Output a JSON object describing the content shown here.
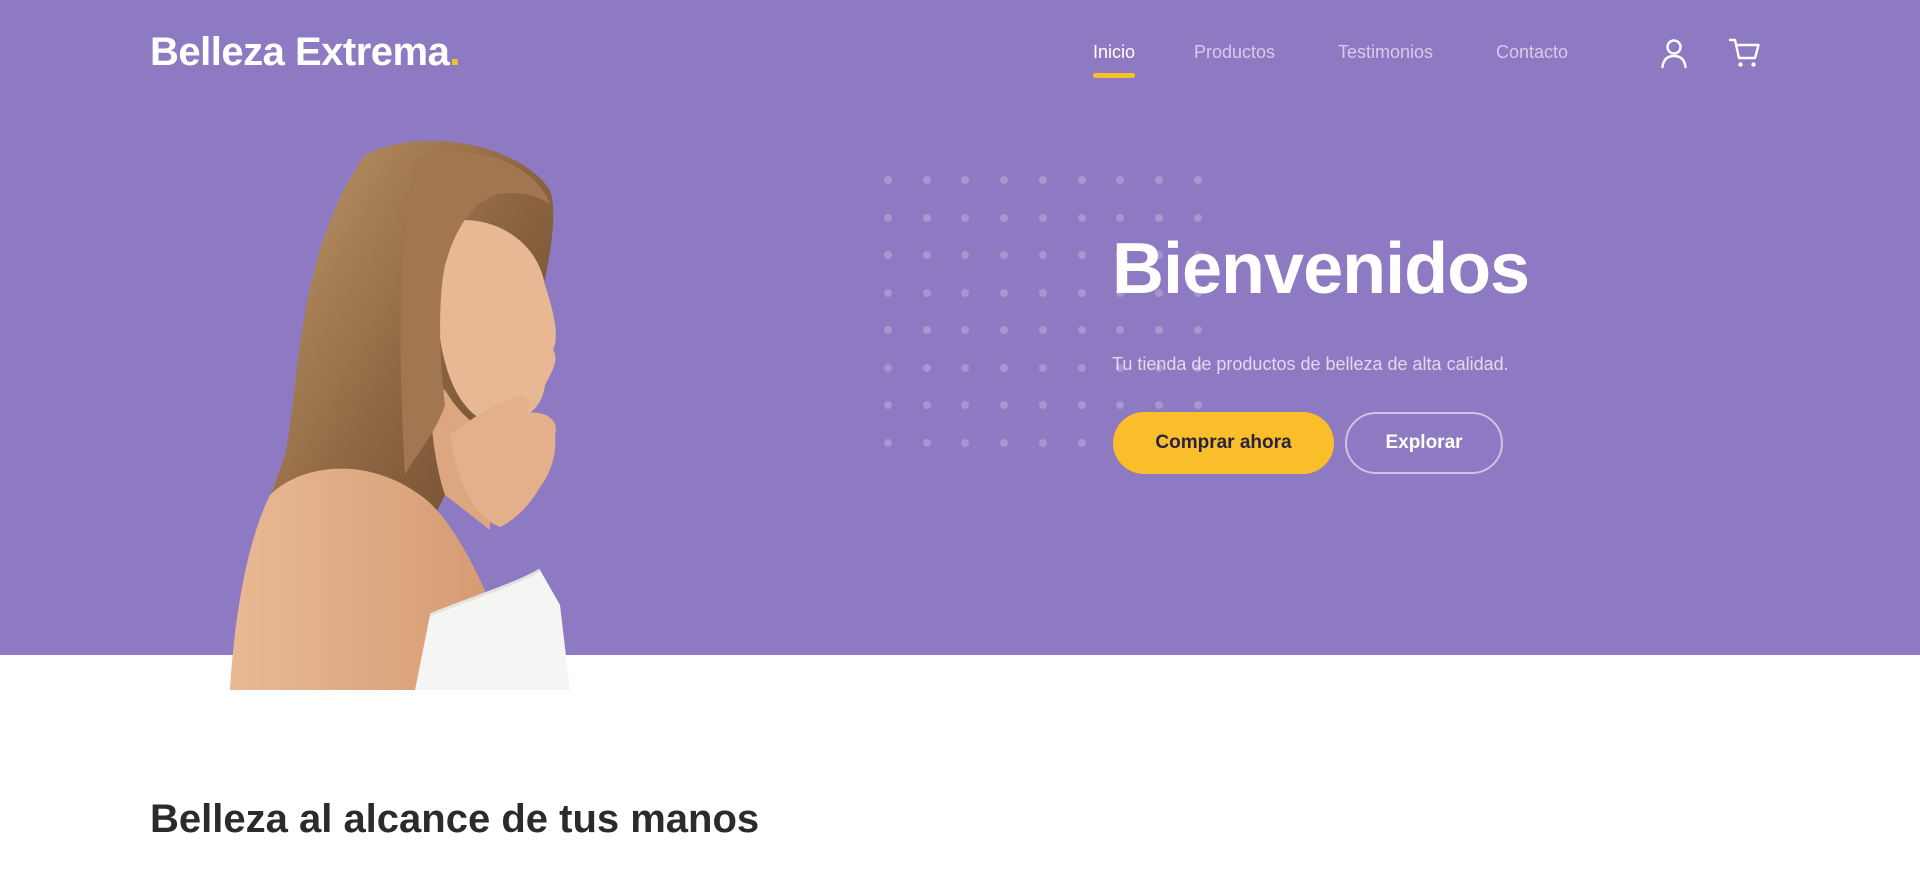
{
  "brand": {
    "name": "Belleza Extrema",
    "dot": "."
  },
  "nav": {
    "items": [
      {
        "label": "Inicio",
        "active": true
      },
      {
        "label": "Productos",
        "active": false
      },
      {
        "label": "Testimonios",
        "active": false
      },
      {
        "label": "Contacto",
        "active": false
      }
    ]
  },
  "header_icons": {
    "account": "user-icon",
    "cart": "cart-icon"
  },
  "hero": {
    "title": "Bienvenidos",
    "subtitle": "Tu tienda de productos de belleza de alta calidad.",
    "primary_button": "Comprar ahora",
    "secondary_button": "Explorar"
  },
  "section": {
    "title": "Belleza al alcance de tus manos"
  },
  "colors": {
    "hero_bg": "#8e7ac2",
    "accent": "#f9be2a",
    "text_dark": "#2b2b2b",
    "white": "#ffffff"
  }
}
